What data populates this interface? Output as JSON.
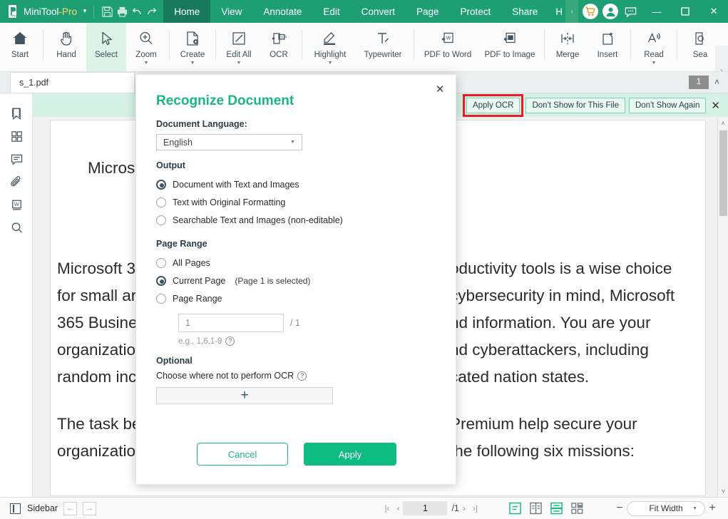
{
  "titlebar": {
    "app_name_main": "MiniTool",
    "app_name_suffix": "-Pro",
    "logo_icon": "minitool-pdf-logo-icon",
    "dropdown_icon": "chevron-down-icon",
    "quick_actions": [
      {
        "name": "save-icon",
        "glyph": "save"
      },
      {
        "name": "print-icon",
        "glyph": "print"
      },
      {
        "name": "undo-icon",
        "glyph": "undo"
      },
      {
        "name": "redo-icon",
        "glyph": "redo"
      }
    ],
    "menus": [
      {
        "label": "Home",
        "active": true
      },
      {
        "label": "View",
        "active": false
      },
      {
        "label": "Annotate",
        "active": false
      },
      {
        "label": "Edit",
        "active": false
      },
      {
        "label": "Convert",
        "active": false
      },
      {
        "label": "Page",
        "active": false
      },
      {
        "label": "Protect",
        "active": false
      },
      {
        "label": "Share",
        "active": false
      },
      {
        "label": "H",
        "active": false
      }
    ],
    "overflow_label": "›",
    "cart_icon": "shopping-cart-icon",
    "account_icon": "user-account-icon",
    "feedback_icon": "chat-bubble-icon",
    "minimize_label": "—",
    "maximize_label": "☐",
    "close_label": "✕",
    "bg_color": "#1e9e73",
    "active_menu_color": "#17795a",
    "pro_color": "#ffd966"
  },
  "ribbon": {
    "items": [
      {
        "label": "Start",
        "icon": "home-icon",
        "arrow": false,
        "active": false,
        "sep_after": true
      },
      {
        "label": "Hand",
        "icon": "hand-icon",
        "arrow": false,
        "active": false,
        "sep_after": false
      },
      {
        "label": "Select",
        "icon": "cursor-arrow-icon",
        "arrow": false,
        "active": true,
        "sep_after": false
      },
      {
        "label": "Zoom",
        "icon": "magnifier-plus-icon",
        "arrow": true,
        "active": false,
        "sep_after": true
      },
      {
        "label": "Create",
        "icon": "create-document-icon",
        "arrow": true,
        "active": false,
        "sep_after": true
      },
      {
        "label": "Edit All",
        "icon": "edit-pencil-square-icon",
        "arrow": true,
        "active": false,
        "sep_after": false
      },
      {
        "label": "OCR",
        "icon": "ocr-icon",
        "arrow": false,
        "active": false,
        "sep_after": true
      },
      {
        "label": "Highlight",
        "icon": "highlighter-icon",
        "arrow": true,
        "active": false,
        "sep_after": false
      },
      {
        "label": "Typewriter",
        "icon": "typewriter-icon",
        "arrow": false,
        "active": false,
        "sep_after": true
      },
      {
        "label": "PDF to Word",
        "icon": "pdf-to-word-icon",
        "arrow": false,
        "active": false,
        "sep_after": false
      },
      {
        "label": "PDF to Image",
        "icon": "pdf-to-image-icon",
        "arrow": false,
        "active": false,
        "sep_after": true
      },
      {
        "label": "Merge",
        "icon": "merge-icon",
        "arrow": false,
        "active": false,
        "sep_after": false
      },
      {
        "label": "Insert",
        "icon": "insert-page-icon",
        "arrow": false,
        "active": false,
        "sep_after": true
      },
      {
        "label": "Read",
        "icon": "read-aloud-icon",
        "arrow": true,
        "active": false,
        "sep_after": true
      },
      {
        "label": "Sea",
        "icon": "search-page-icon",
        "arrow": false,
        "active": false,
        "sep_after": false
      }
    ],
    "expand_icon": "chevron-right-icon"
  },
  "tabstrip": {
    "document_tab": "s_1.pdf",
    "page_badge": "1",
    "collapse_icon": "chevron-up-icon"
  },
  "rail": {
    "items": [
      {
        "name": "bookmark-icon",
        "label": "Bookmark"
      },
      {
        "name": "thumbnails-icon",
        "label": "Thumbnails"
      },
      {
        "name": "comments-icon",
        "label": "Comments"
      },
      {
        "name": "attachments-icon",
        "label": "Attachments"
      },
      {
        "name": "word-export-icon",
        "label": "Word"
      },
      {
        "name": "search-icon",
        "label": "Search"
      }
    ]
  },
  "notification": {
    "apply_ocr": "Apply OCR",
    "dont_show_file": "Don't Show for This File",
    "dont_show_again": "Don't Show Again",
    "close_icon": "close-icon",
    "highlight_color": "#ee1c25",
    "bg_color": "#d6f2e6"
  },
  "document": {
    "paragraphs": [
      "Microsoft 3                                                      oductivity tools is a wise choice",
      "for small ar                                                      cybersecurity in mind, Microsoft",
      "365 Busine                                                      nd information. You are your",
      "organizatio                                                      nd cyberattackers, including",
      "random inc                                                      cated nation states.",
      "The task be                                                      Premium help secure your",
      "organizatio                                                      the following six missions:"
    ],
    "left_lines": [
      "Microsoft 3",
      "for small ar",
      "365 Busine",
      "organizatio",
      "random inc"
    ],
    "left_lines2": [
      "The task be",
      "organizatio"
    ],
    "right_lines": [
      "oductivity tools is a wise choice",
      "cybersecurity in mind, Microsoft",
      "nd information. You are your",
      "nd cyberattackers, including",
      "cated nation states."
    ],
    "right_lines2": [
      "Premium help secure your",
      "the following six missions:"
    ]
  },
  "statusbar": {
    "sidebar_label": "Sidebar",
    "sidebar_icon": "sidebar-toggle-icon",
    "nav_back_icon": "arrow-left-icon",
    "nav_forward_icon": "arrow-right-icon",
    "first_page_icon": "first-page-icon",
    "prev_page_icon": "prev-page-icon",
    "next_page_icon": "next-page-icon",
    "last_page_icon": "last-page-icon",
    "current_page": "1",
    "total_pages": "/1",
    "view_modes": [
      {
        "name": "single-page-view-icon",
        "active": true
      },
      {
        "name": "two-page-view-icon",
        "active": false
      },
      {
        "name": "continuous-scroll-icon",
        "active": true
      },
      {
        "name": "grid-view-icon",
        "active": false
      }
    ],
    "zoom_out_label": "−",
    "zoom_in_label": "+",
    "zoom_value": "Fit Width",
    "zoom_caret_icon": "chevron-down-icon",
    "accent_color": "#14b87f"
  },
  "modal": {
    "title": "Recognize Document",
    "close_icon": "close-icon",
    "language_label": "Document Language:",
    "language_value": "English",
    "language_caret_icon": "chevron-down-icon",
    "output_section": "Output",
    "output_options": [
      {
        "label": "Document with Text and Images",
        "selected": true
      },
      {
        "label": "Text with Original Formatting",
        "selected": false
      },
      {
        "label": "Searchable Text and Images (non-editable)",
        "selected": false
      }
    ],
    "page_range_section": "Page Range",
    "page_range_options": [
      {
        "label": "All Pages",
        "note": "",
        "selected": false
      },
      {
        "label": "Current Page",
        "note": "(Page 1 is selected)",
        "selected": true
      },
      {
        "label": "Page Range",
        "note": "",
        "selected": false
      }
    ],
    "range_input_value": "1",
    "range_total": "/ 1",
    "range_hint": "e.g., 1,6,1-9",
    "range_help_icon": "help-circle-icon",
    "optional_section": "Optional",
    "optional_text": "Choose where not to perform OCR",
    "optional_help_icon": "help-circle-icon",
    "add_area_label": "+",
    "cancel_label": "Cancel",
    "apply_label": "Apply",
    "title_color": "#19b87d",
    "apply_bg_color": "#0ebb80"
  }
}
